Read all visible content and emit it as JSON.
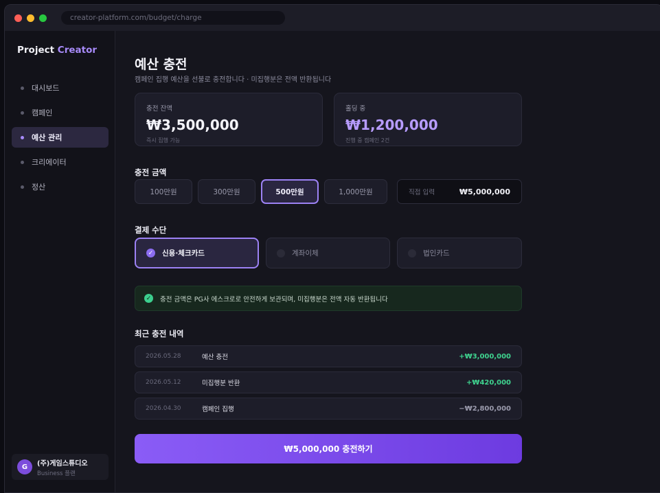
{
  "browser": {
    "url": "creator-platform.com/budget/charge",
    "dots": [
      "#ff5f57",
      "#febc2e",
      "#28c840"
    ]
  },
  "sidebar": {
    "brand_main": "Project",
    "brand_accent": "Creator",
    "items": [
      {
        "label": "대시보드",
        "active": false
      },
      {
        "label": "캠페인",
        "active": false
      },
      {
        "label": "예산 관리",
        "active": true
      },
      {
        "label": "크리에이터",
        "active": false
      },
      {
        "label": "정산",
        "active": false
      }
    ],
    "account": {
      "initial": "G",
      "name": "(주)게임스튜디오",
      "plan": "Business 플랜"
    }
  },
  "main": {
    "title": "예산 충전",
    "subtitle": "캠페인 집행 예산을 선불로 충전합니다 · 미집행분은 전액 반환됩니다",
    "cards": [
      {
        "label": "충전 잔액",
        "value": "₩3,500,000",
        "note": "즉시 집행 가능"
      },
      {
        "label": "홀딩 중",
        "value": "₩1,200,000",
        "note": "진행 중 캠페인 2건"
      }
    ],
    "amount_section": "충전 금액",
    "amounts": [
      "100만원",
      "300만원",
      "500만원",
      "1,000만원"
    ],
    "selected_amount_index": 2,
    "custom_input": {
      "placeholder": "직접 입력",
      "value": "₩5,000,000"
    },
    "payment_section": "결제 수단",
    "payments": [
      "신용·체크카드",
      "계좌이체",
      "법인카드"
    ],
    "selected_payment_index": 0,
    "notice": "충전 금액은 PG사 에스크로로 안전하게 보관되며, 미집행분은 전액 자동 반환됩니다",
    "history_section": "최근 충전 내역",
    "history": [
      {
        "date": "2026.05.28",
        "desc": "예산 충전",
        "amount": "+₩3,000,000",
        "type": "plus"
      },
      {
        "date": "2026.05.12",
        "desc": "미집행분 반환",
        "amount": "+₩420,000",
        "type": "plus"
      },
      {
        "date": "2026.04.30",
        "desc": "캠페인 집행",
        "amount": "−₩2,800,000",
        "type": "minus"
      }
    ],
    "cta": "₩5,000,000 충전하기"
  }
}
